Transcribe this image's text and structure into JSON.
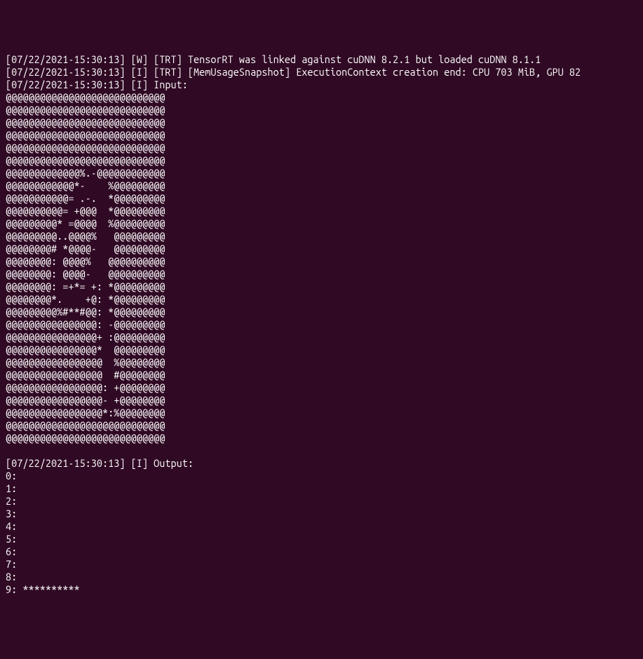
{
  "terminal": {
    "lines": [
      "[07/22/2021-15:30:13] [W] [TRT] TensorRT was linked against cuDNN 8.2.1 but loaded cuDNN 8.1.1",
      "[07/22/2021-15:30:13] [I] [TRT] [MemUsageSnapshot] ExecutionContext creation end: CPU 703 MiB, GPU 82",
      "[07/22/2021-15:30:13] [I] Input:",
      "@@@@@@@@@@@@@@@@@@@@@@@@@@@@",
      "@@@@@@@@@@@@@@@@@@@@@@@@@@@@",
      "@@@@@@@@@@@@@@@@@@@@@@@@@@@@",
      "@@@@@@@@@@@@@@@@@@@@@@@@@@@@",
      "@@@@@@@@@@@@@@@@@@@@@@@@@@@@",
      "@@@@@@@@@@@@@@@@@@@@@@@@@@@@",
      "@@@@@@@@@@@@@%.-@@@@@@@@@@@@",
      "@@@@@@@@@@@@*-    %@@@@@@@@@",
      "@@@@@@@@@@@= .-.  *@@@@@@@@@",
      "@@@@@@@@@@= +@@@  *@@@@@@@@@",
      "@@@@@@@@@* =@@@@  %@@@@@@@@@",
      "@@@@@@@@@..@@@@%   @@@@@@@@@",
      "@@@@@@@@# *@@@@-   @@@@@@@@@",
      "@@@@@@@@: @@@@%   @@@@@@@@@@",
      "@@@@@@@@: @@@@-   @@@@@@@@@@",
      "@@@@@@@@: =+*= +: *@@@@@@@@@",
      "@@@@@@@@*.    +@: *@@@@@@@@@",
      "@@@@@@@@@%#**#@@: *@@@@@@@@@",
      "@@@@@@@@@@@@@@@@: -@@@@@@@@@",
      "@@@@@@@@@@@@@@@@+ :@@@@@@@@@",
      "@@@@@@@@@@@@@@@@*  @@@@@@@@@",
      "@@@@@@@@@@@@@@@@@  %@@@@@@@@",
      "@@@@@@@@@@@@@@@@@  #@@@@@@@@",
      "@@@@@@@@@@@@@@@@@: +@@@@@@@@",
      "@@@@@@@@@@@@@@@@@- +@@@@@@@@",
      "@@@@@@@@@@@@@@@@@*:%@@@@@@@@",
      "@@@@@@@@@@@@@@@@@@@@@@@@@@@@",
      "@@@@@@@@@@@@@@@@@@@@@@@@@@@@",
      "",
      "[07/22/2021-15:30:13] [I] Output:",
      "0: ",
      "1: ",
      "2: ",
      "3: ",
      "4: ",
      "5: ",
      "6: ",
      "7: ",
      "8: ",
      "9: **********"
    ]
  }
}
